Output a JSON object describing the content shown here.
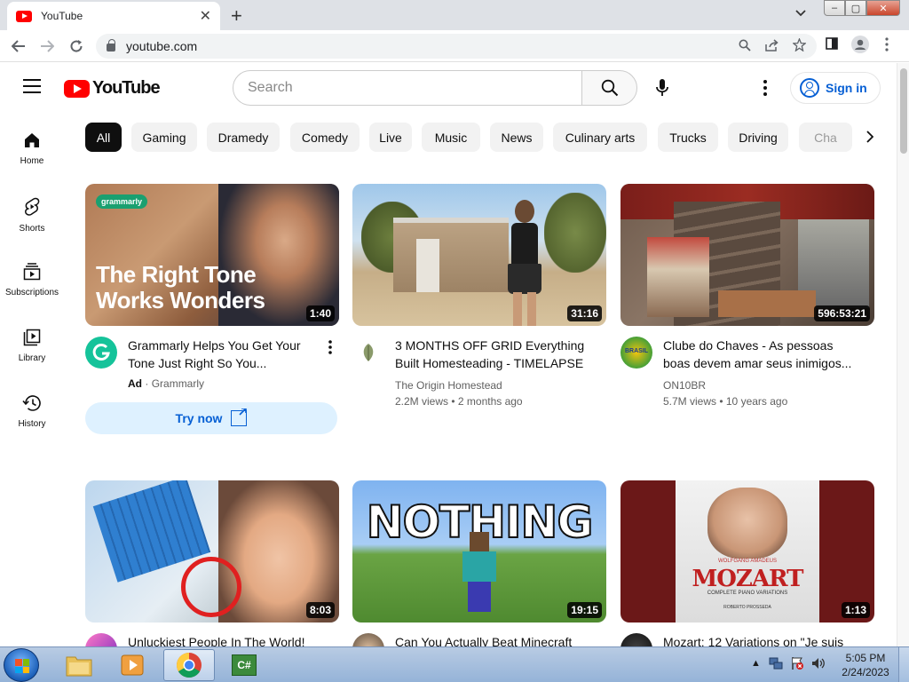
{
  "browser": {
    "tab_title": "YouTube",
    "url": "youtube.com",
    "window_controls": {
      "minimize": "–",
      "maximize": "▢",
      "close": "✕"
    }
  },
  "youtube": {
    "logo_text": "YouTube",
    "search_placeholder": "Search",
    "sign_in": "Sign in",
    "chips": [
      "All",
      "Gaming",
      "Dramedy",
      "Comedy",
      "Live",
      "Music",
      "News",
      "Culinary arts",
      "Trucks",
      "Driving",
      "Cha"
    ],
    "guide": [
      {
        "label": "Home",
        "icon": "home-icon"
      },
      {
        "label": "Shorts",
        "icon": "shorts-icon"
      },
      {
        "label": "Subscriptions",
        "icon": "subscriptions-icon"
      },
      {
        "label": "Library",
        "icon": "library-icon"
      },
      {
        "label": "History",
        "icon": "history-icon"
      }
    ],
    "videos": [
      {
        "title": "Grammarly Helps You Get Your Tone Just Right So You...",
        "ad_badge": "Ad",
        "channel": "Grammarly",
        "duration": "1:40",
        "thumb_brand": "grammarly",
        "thumb_text": "The Right Tone Works Wonders",
        "cta": "Try now"
      },
      {
        "title": "3 MONTHS OFF GRID Everything Built Homesteading - TIMELAPSE",
        "channel": "The Origin Homestead",
        "meta": "2.2M views • 2 months ago",
        "duration": "31:16"
      },
      {
        "title": "Clube do Chaves - As pessoas boas devem amar seus inimigos...",
        "channel": "ON10BR",
        "meta": "5.7M views • 10 years ago",
        "duration": "596:53:21",
        "avatar_text": "BRASIL"
      },
      {
        "title": "Unluckiest People In The World!",
        "duration": "8:03"
      },
      {
        "title": "Can You Actually Beat Minecraft",
        "duration": "19:15",
        "thumb_text": "NOTHING"
      },
      {
        "title": "Mozart: 12 Variations on \"Je suis",
        "duration": "1:13",
        "thumb_text": "MOZART",
        "thumb_small_1": "WOLFGANG AMADEUS",
        "thumb_small_2": "COMPLETE PIANO VARIATIONS",
        "thumb_small_3": "ROBERTO PROSSEDA"
      }
    ]
  },
  "taskbar": {
    "time": "5:05 PM",
    "date": "2/24/2023",
    "csharp_label": "C#"
  }
}
